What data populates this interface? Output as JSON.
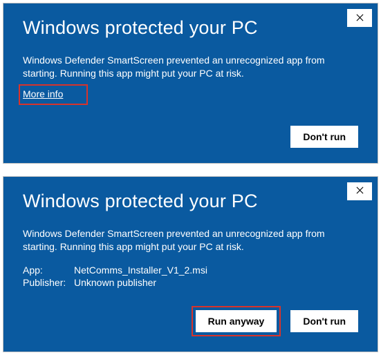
{
  "dialog1": {
    "title": "Windows protected your PC",
    "body": "Windows Defender SmartScreen prevented an unrecognized app from starting. Running this app might put your PC at risk.",
    "more_info": "More info",
    "dont_run": "Don't run"
  },
  "dialog2": {
    "title": "Windows protected your PC",
    "body": "Windows Defender SmartScreen prevented an unrecognized app from starting. Running this app might put your PC at risk.",
    "app_label": "App:",
    "app_value": "NetComms_Installer_V1_2.msi",
    "publisher_label": "Publisher:",
    "publisher_value": "Unknown publisher",
    "run_anyway": "Run anyway",
    "dont_run": "Don't run"
  },
  "colors": {
    "dialog_bg": "#0a5aa0",
    "highlight": "#d9332a"
  }
}
